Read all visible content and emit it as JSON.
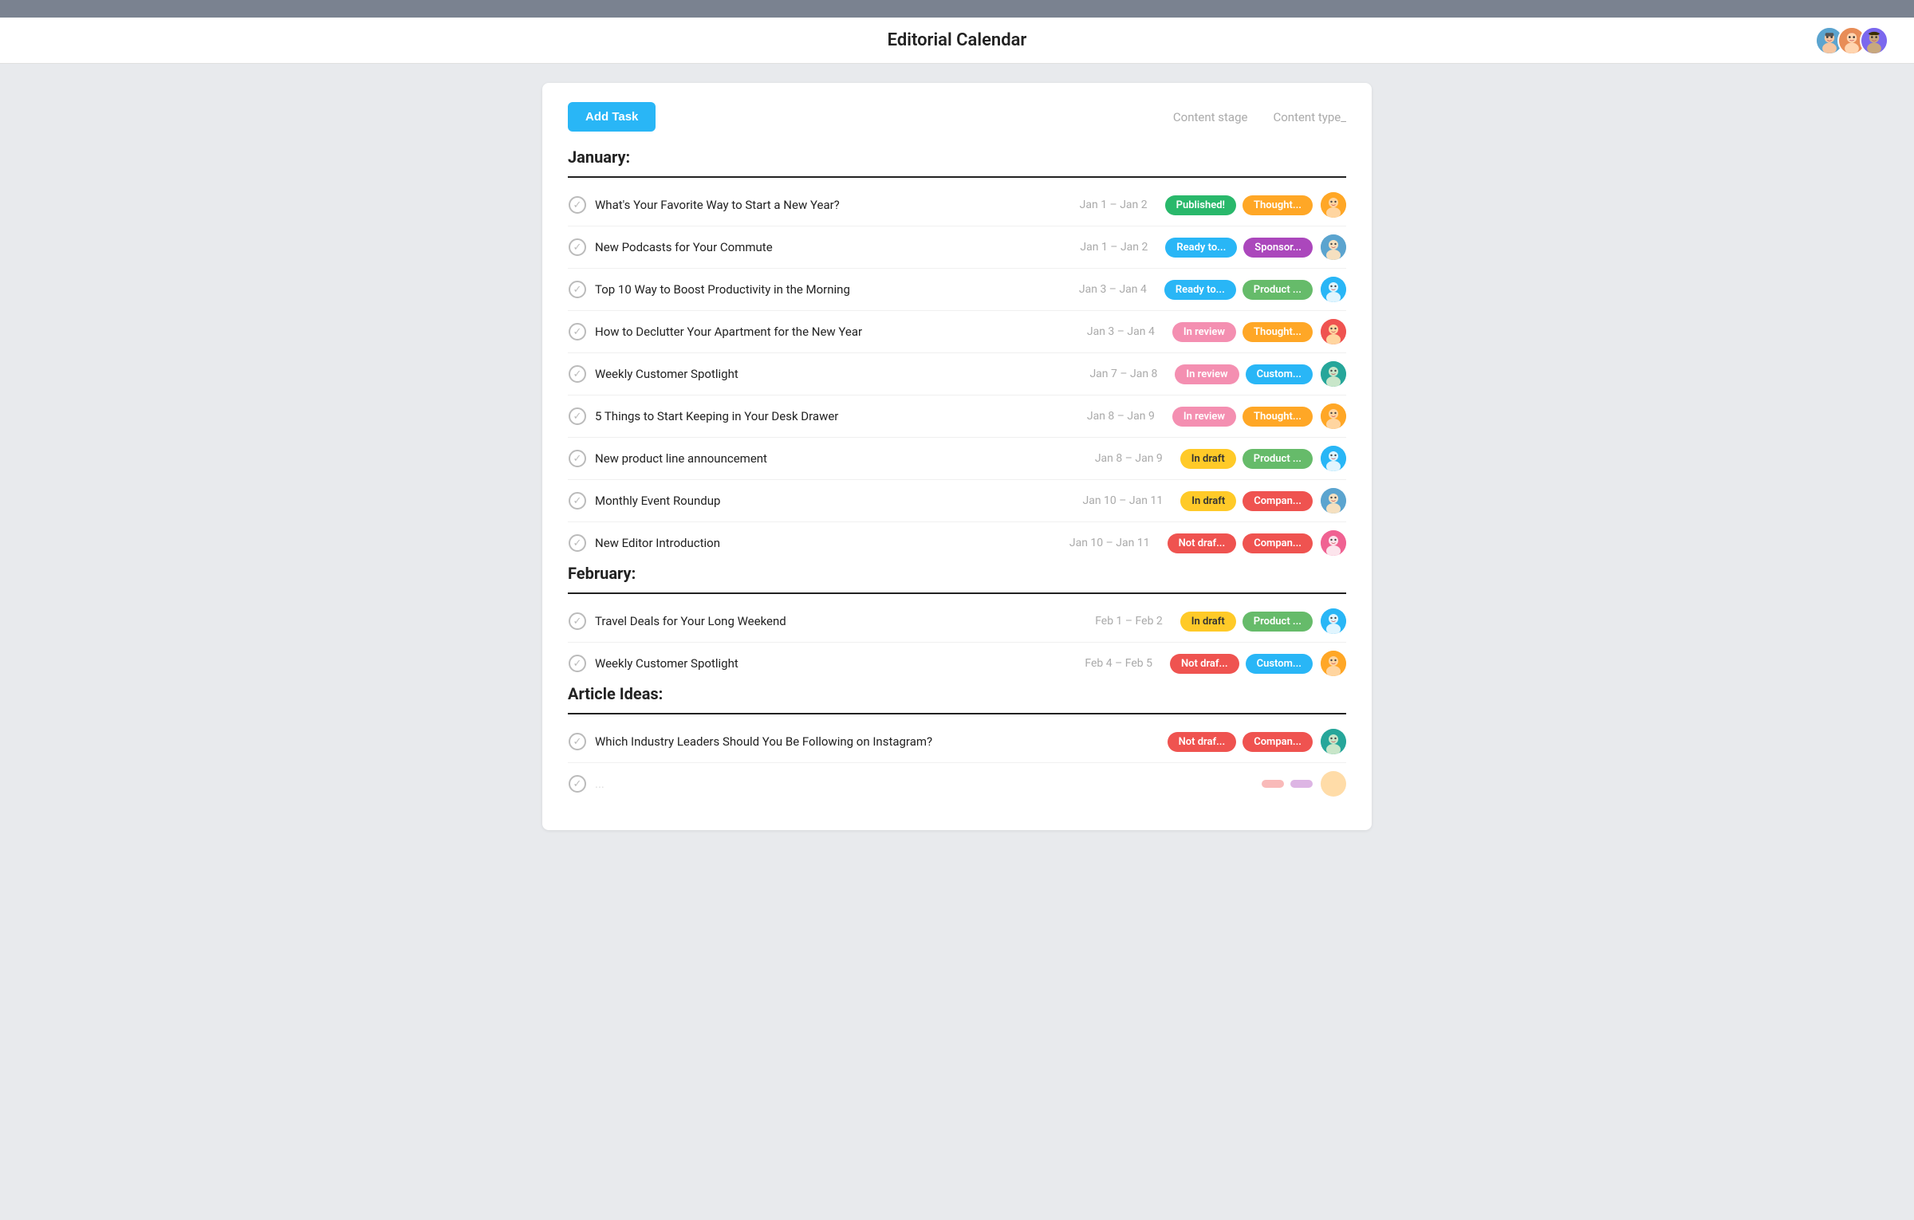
{
  "topbar": {},
  "header": {
    "title": "Editorial Calendar",
    "avatars": [
      {
        "id": "av1",
        "color": "#5ba4cf",
        "initial": "A"
      },
      {
        "id": "av2",
        "color": "#e88d57",
        "initial": "B"
      },
      {
        "id": "av3",
        "color": "#7b68ee",
        "initial": "C"
      }
    ]
  },
  "toolbar": {
    "add_task_label": "Add Task",
    "filter1": "Content stage",
    "filter2": "Content type_"
  },
  "sections": [
    {
      "id": "january",
      "title": "January:",
      "tasks": [
        {
          "id": "t1",
          "title": "What's Your Favorite Way to Start a New Year?",
          "dates": "Jan 1 – Jan 2",
          "status_label": "Published!",
          "status_class": "badge-published",
          "type_label": "Thought...",
          "type_class": "badge-thought",
          "avatar_class": "rav1"
        },
        {
          "id": "t2",
          "title": "New Podcasts for Your Commute",
          "dates": "Jan 1 – Jan 2",
          "status_label": "Ready to...",
          "status_class": "badge-ready",
          "type_label": "Sponsor...",
          "type_class": "badge-sponsor",
          "avatar_class": "rav2"
        },
        {
          "id": "t3",
          "title": "Top 10 Way to Boost Productivity in the Morning",
          "dates": "Jan 3 – Jan 4",
          "status_label": "Ready to...",
          "status_class": "badge-ready",
          "type_label": "Product ...",
          "type_class": "badge-product",
          "avatar_class": "rav7"
        },
        {
          "id": "t4",
          "title": "How to Declutter Your Apartment for the New Year",
          "dates": "Jan 3 – Jan 4",
          "status_label": "In review",
          "status_class": "badge-inreview",
          "type_label": "Thought...",
          "type_class": "badge-thought",
          "avatar_class": "rav4"
        },
        {
          "id": "t5",
          "title": "Weekly Customer Spotlight",
          "dates": "Jan 7 – Jan 8",
          "status_label": "In review",
          "status_class": "badge-inreview",
          "type_label": "Custom...",
          "type_class": "badge-custom",
          "avatar_class": "rav3"
        },
        {
          "id": "t6",
          "title": "5 Things to Start Keeping in Your Desk Drawer",
          "dates": "Jan 8 – Jan 9",
          "status_label": "In review",
          "status_class": "badge-inreview",
          "type_label": "Thought...",
          "type_class": "badge-thought",
          "avatar_class": "rav1"
        },
        {
          "id": "t7",
          "title": "New product line announcement",
          "dates": "Jan 8 – Jan 9",
          "status_label": "In draft",
          "status_class": "badge-indraft",
          "type_label": "Product ...",
          "type_class": "badge-product",
          "avatar_class": "rav7"
        },
        {
          "id": "t8",
          "title": "Monthly Event Roundup",
          "dates": "Jan 10 – Jan 11",
          "status_label": "In draft",
          "status_class": "badge-indraft",
          "type_label": "Compan...",
          "type_class": "badge-company",
          "avatar_class": "rav2"
        },
        {
          "id": "t9",
          "title": "New Editor Introduction",
          "dates": "Jan 10 – Jan 11",
          "status_label": "Not draf...",
          "status_class": "badge-notdraft",
          "type_label": "Compan...",
          "type_class": "badge-company",
          "avatar_class": "rav6"
        }
      ]
    },
    {
      "id": "february",
      "title": "February:",
      "tasks": [
        {
          "id": "f1",
          "title": "Travel Deals for Your Long Weekend",
          "dates": "Feb 1 – Feb 2",
          "status_label": "In draft",
          "status_class": "badge-indraft",
          "type_label": "Product ...",
          "type_class": "badge-product",
          "avatar_class": "rav7"
        },
        {
          "id": "f2",
          "title": "Weekly Customer Spotlight",
          "dates": "Feb 4 – Feb 5",
          "status_label": "Not draf...",
          "status_class": "badge-notdraft",
          "type_label": "Custom...",
          "type_class": "badge-custom",
          "avatar_class": "rav1"
        }
      ]
    },
    {
      "id": "article-ideas",
      "title": "Article Ideas:",
      "tasks": [
        {
          "id": "a1",
          "title": "Which Industry Leaders Should You Be Following on Instagram?",
          "dates": "",
          "status_label": "Not draf...",
          "status_class": "badge-notdraft",
          "type_label": "Compan...",
          "type_class": "badge-company",
          "avatar_class": "rav3"
        },
        {
          "id": "a2",
          "title": "",
          "dates": "",
          "status_label": "",
          "status_class": "badge-notdraft",
          "type_label": "",
          "type_class": "badge-sponsor",
          "avatar_class": "rav1"
        }
      ]
    }
  ]
}
